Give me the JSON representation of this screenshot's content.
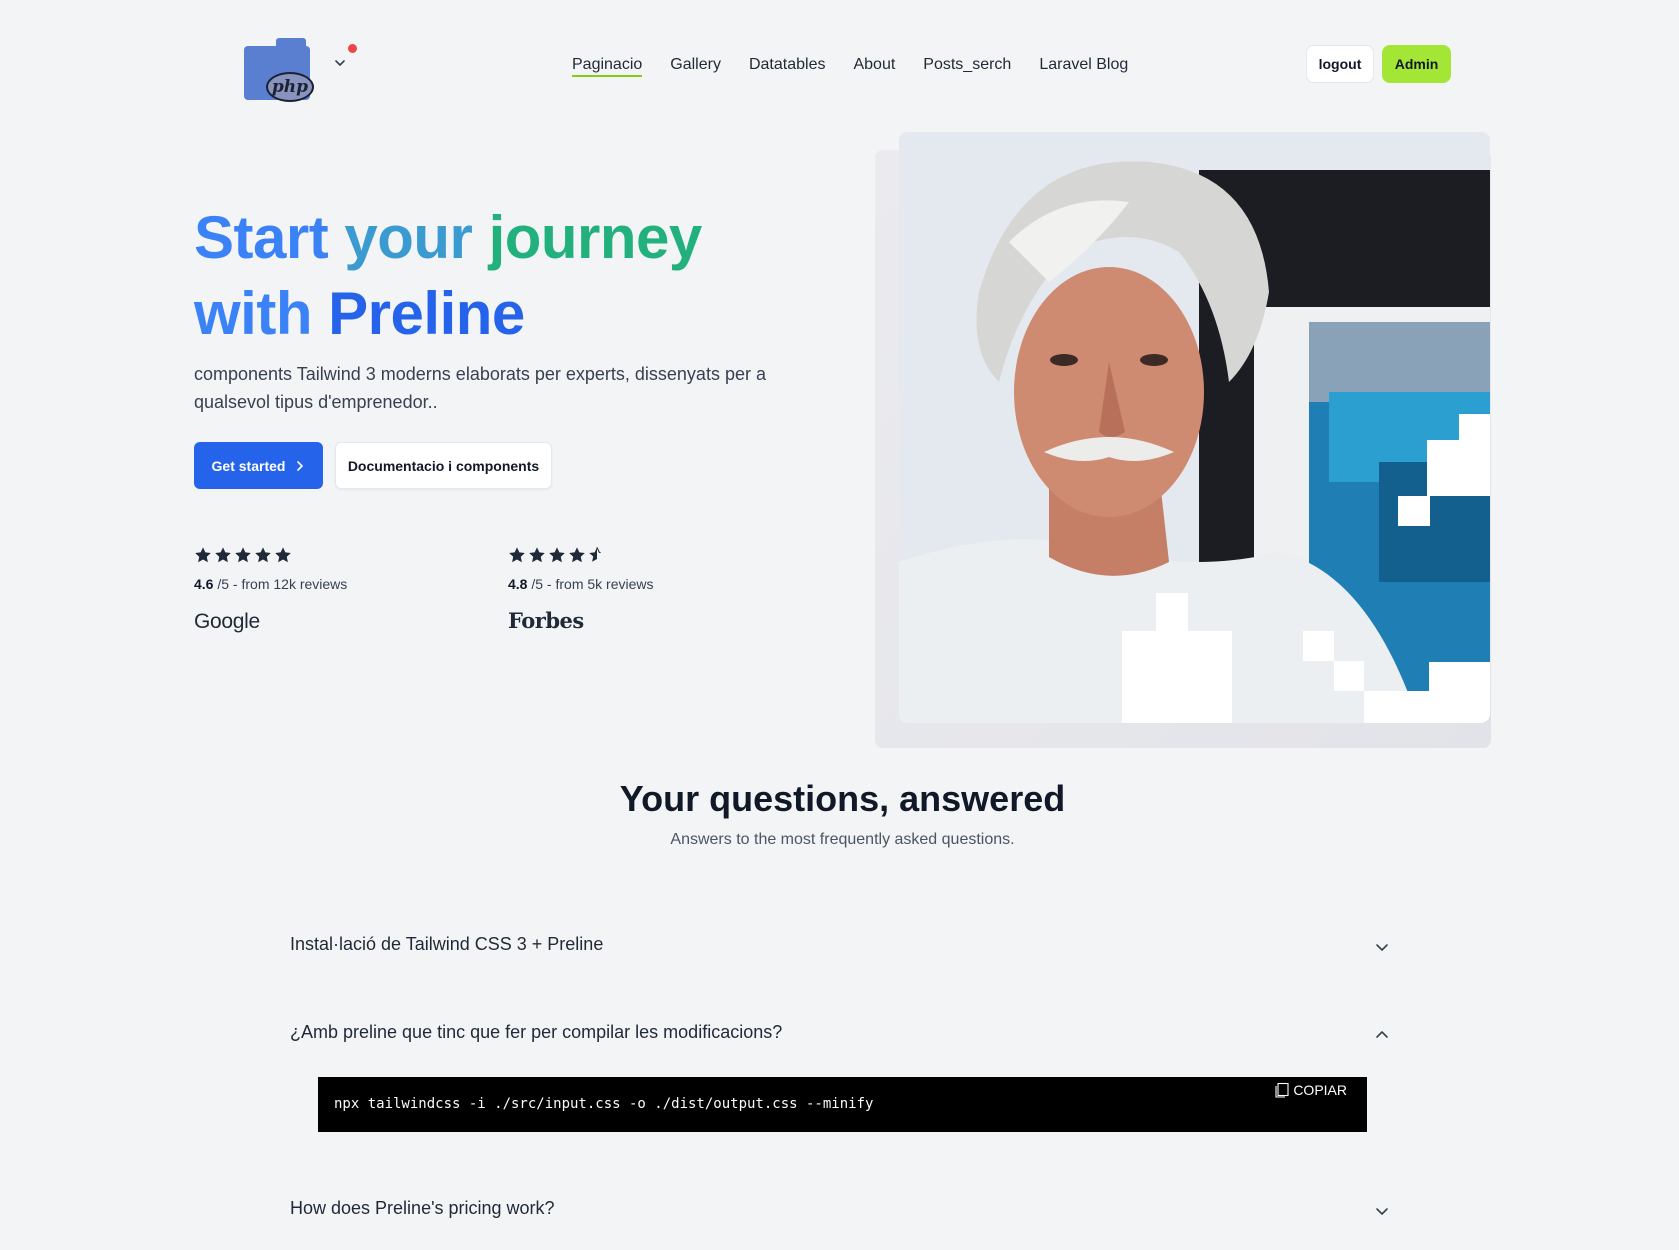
{
  "header": {
    "logo_text": "php",
    "nav": [
      {
        "label": "Paginacio",
        "active": true
      },
      {
        "label": "Gallery",
        "active": false
      },
      {
        "label": "Datatables",
        "active": false
      },
      {
        "label": "About",
        "active": false
      },
      {
        "label": "Posts_serch",
        "active": false
      },
      {
        "label": "Laravel Blog",
        "active": false
      }
    ],
    "logout_label": "logout",
    "admin_label": "Admin"
  },
  "hero": {
    "title_words": [
      "Start",
      "your",
      "journey",
      "with",
      "Preline"
    ],
    "subtitle": "components Tailwind 3 moderns elaborats per experts, dissenyats per a qualsevol tipus d'emprenedor..",
    "primary_button": "Get started",
    "secondary_button": "Documentacio i components",
    "reviews": [
      {
        "score": "4.6",
        "suffix": " /5 - from 12k reviews",
        "brand": "Google",
        "stars": 5
      },
      {
        "score": "4.8",
        "suffix": " /5 - from 5k reviews",
        "brand": "Forbes",
        "stars": 4.5
      }
    ]
  },
  "faq": {
    "title": "Your questions, answered",
    "subtitle": "Answers to the most frequently asked questions.",
    "items": [
      {
        "question": "Instal·lació de Tailwind CSS 3 + Preline",
        "open": false
      },
      {
        "question": "¿Amb preline que tinc que fer per compilar les modificacions?",
        "open": true
      },
      {
        "question": "How does Preline's pricing work?",
        "open": false
      }
    ],
    "code": "npx tailwindcss -i ./src/input.css -o ./dist/output.css --minify",
    "copy_label": "COPIAR"
  },
  "colors": {
    "primary": "#2563eb",
    "accent_lime": "#a3e635",
    "nav_underline": "#84cc16",
    "notification": "#ef4444",
    "background": "#f3f4f6"
  }
}
